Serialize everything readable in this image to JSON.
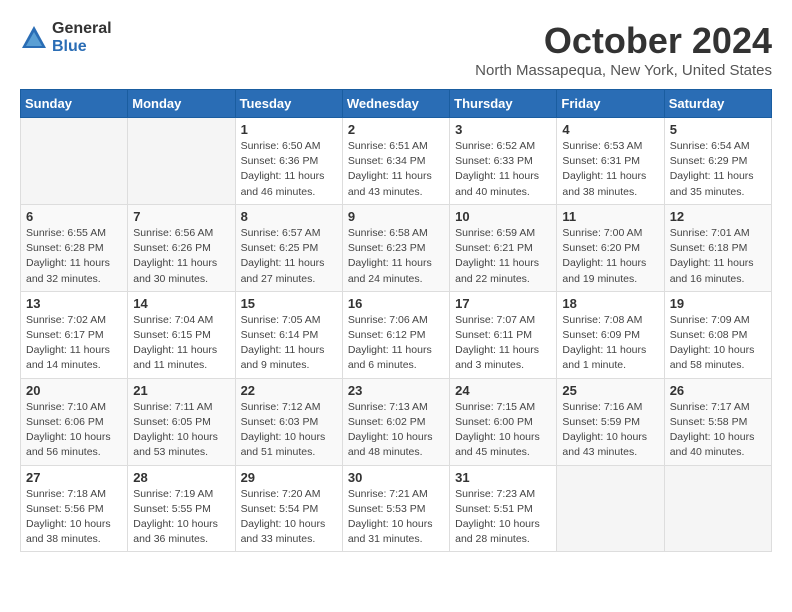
{
  "header": {
    "logo_general": "General",
    "logo_blue": "Blue",
    "month_title": "October 2024",
    "location": "North Massapequa, New York, United States"
  },
  "weekdays": [
    "Sunday",
    "Monday",
    "Tuesday",
    "Wednesday",
    "Thursday",
    "Friday",
    "Saturday"
  ],
  "weeks": [
    [
      {
        "day": "",
        "info": ""
      },
      {
        "day": "",
        "info": ""
      },
      {
        "day": "1",
        "info": "Sunrise: 6:50 AM\nSunset: 6:36 PM\nDaylight: 11 hours and 46 minutes."
      },
      {
        "day": "2",
        "info": "Sunrise: 6:51 AM\nSunset: 6:34 PM\nDaylight: 11 hours and 43 minutes."
      },
      {
        "day": "3",
        "info": "Sunrise: 6:52 AM\nSunset: 6:33 PM\nDaylight: 11 hours and 40 minutes."
      },
      {
        "day": "4",
        "info": "Sunrise: 6:53 AM\nSunset: 6:31 PM\nDaylight: 11 hours and 38 minutes."
      },
      {
        "day": "5",
        "info": "Sunrise: 6:54 AM\nSunset: 6:29 PM\nDaylight: 11 hours and 35 minutes."
      }
    ],
    [
      {
        "day": "6",
        "info": "Sunrise: 6:55 AM\nSunset: 6:28 PM\nDaylight: 11 hours and 32 minutes."
      },
      {
        "day": "7",
        "info": "Sunrise: 6:56 AM\nSunset: 6:26 PM\nDaylight: 11 hours and 30 minutes."
      },
      {
        "day": "8",
        "info": "Sunrise: 6:57 AM\nSunset: 6:25 PM\nDaylight: 11 hours and 27 minutes."
      },
      {
        "day": "9",
        "info": "Sunrise: 6:58 AM\nSunset: 6:23 PM\nDaylight: 11 hours and 24 minutes."
      },
      {
        "day": "10",
        "info": "Sunrise: 6:59 AM\nSunset: 6:21 PM\nDaylight: 11 hours and 22 minutes."
      },
      {
        "day": "11",
        "info": "Sunrise: 7:00 AM\nSunset: 6:20 PM\nDaylight: 11 hours and 19 minutes."
      },
      {
        "day": "12",
        "info": "Sunrise: 7:01 AM\nSunset: 6:18 PM\nDaylight: 11 hours and 16 minutes."
      }
    ],
    [
      {
        "day": "13",
        "info": "Sunrise: 7:02 AM\nSunset: 6:17 PM\nDaylight: 11 hours and 14 minutes."
      },
      {
        "day": "14",
        "info": "Sunrise: 7:04 AM\nSunset: 6:15 PM\nDaylight: 11 hours and 11 minutes."
      },
      {
        "day": "15",
        "info": "Sunrise: 7:05 AM\nSunset: 6:14 PM\nDaylight: 11 hours and 9 minutes."
      },
      {
        "day": "16",
        "info": "Sunrise: 7:06 AM\nSunset: 6:12 PM\nDaylight: 11 hours and 6 minutes."
      },
      {
        "day": "17",
        "info": "Sunrise: 7:07 AM\nSunset: 6:11 PM\nDaylight: 11 hours and 3 minutes."
      },
      {
        "day": "18",
        "info": "Sunrise: 7:08 AM\nSunset: 6:09 PM\nDaylight: 11 hours and 1 minute."
      },
      {
        "day": "19",
        "info": "Sunrise: 7:09 AM\nSunset: 6:08 PM\nDaylight: 10 hours and 58 minutes."
      }
    ],
    [
      {
        "day": "20",
        "info": "Sunrise: 7:10 AM\nSunset: 6:06 PM\nDaylight: 10 hours and 56 minutes."
      },
      {
        "day": "21",
        "info": "Sunrise: 7:11 AM\nSunset: 6:05 PM\nDaylight: 10 hours and 53 minutes."
      },
      {
        "day": "22",
        "info": "Sunrise: 7:12 AM\nSunset: 6:03 PM\nDaylight: 10 hours and 51 minutes."
      },
      {
        "day": "23",
        "info": "Sunrise: 7:13 AM\nSunset: 6:02 PM\nDaylight: 10 hours and 48 minutes."
      },
      {
        "day": "24",
        "info": "Sunrise: 7:15 AM\nSunset: 6:00 PM\nDaylight: 10 hours and 45 minutes."
      },
      {
        "day": "25",
        "info": "Sunrise: 7:16 AM\nSunset: 5:59 PM\nDaylight: 10 hours and 43 minutes."
      },
      {
        "day": "26",
        "info": "Sunrise: 7:17 AM\nSunset: 5:58 PM\nDaylight: 10 hours and 40 minutes."
      }
    ],
    [
      {
        "day": "27",
        "info": "Sunrise: 7:18 AM\nSunset: 5:56 PM\nDaylight: 10 hours and 38 minutes."
      },
      {
        "day": "28",
        "info": "Sunrise: 7:19 AM\nSunset: 5:55 PM\nDaylight: 10 hours and 36 minutes."
      },
      {
        "day": "29",
        "info": "Sunrise: 7:20 AM\nSunset: 5:54 PM\nDaylight: 10 hours and 33 minutes."
      },
      {
        "day": "30",
        "info": "Sunrise: 7:21 AM\nSunset: 5:53 PM\nDaylight: 10 hours and 31 minutes."
      },
      {
        "day": "31",
        "info": "Sunrise: 7:23 AM\nSunset: 5:51 PM\nDaylight: 10 hours and 28 minutes."
      },
      {
        "day": "",
        "info": ""
      },
      {
        "day": "",
        "info": ""
      }
    ]
  ]
}
